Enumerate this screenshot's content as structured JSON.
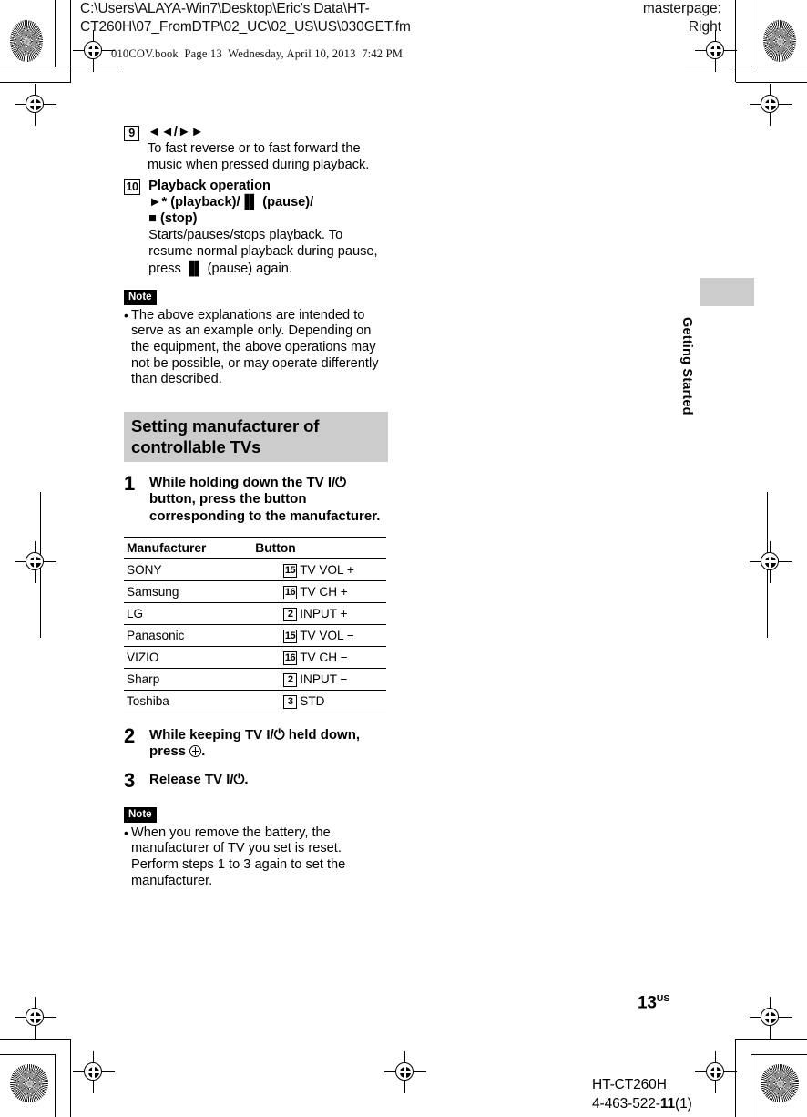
{
  "header": {
    "file_path_line1": "C:\\Users\\ALAYA-Win7\\Desktop\\Eric's Data\\HT-",
    "file_path_line2": "CT260H\\07_FromDTP\\02_UC\\02_US\\US\\030GET.fm",
    "masterpage_label": "masterpage:",
    "masterpage_value": "Right",
    "book_line": "010COV.book  Page 13  Wednesday, April 10, 2013  7:42 PM"
  },
  "body": {
    "items": [
      {
        "number": "9",
        "title": "◄◄/►►",
        "description": "To fast reverse or to fast forward the music when pressed during playback."
      },
      {
        "number": "10",
        "title_line1": "Playback operation",
        "title_line2": "►* (playback)/▐▌ (pause)/",
        "title_line3": "■ (stop)",
        "description_part1": "Starts/pauses/stops playback. To resume normal playback during pause, press ",
        "description_pause_glyph": "▐▌",
        "description_part2": " (pause) again."
      }
    ],
    "note1": {
      "tag": "Note",
      "bullet": "•",
      "text": "The above explanations are intended to serve as an example only. Depending on the equipment, the above operations may not be possible, or may operate differently than described."
    },
    "section_heading": "Setting manufacturer of controllable TVs",
    "steps": [
      {
        "number": "1",
        "text_before": "While holding down the TV ",
        "power_glyph": "I/⏻",
        "text_after": " button, press the button corresponding to the manufacturer."
      },
      {
        "number": "2",
        "text_before": "While keeping TV ",
        "power_glyph": "I/⏻",
        "text_mid": " held down, press ",
        "enter_icon": "enter-icon",
        "text_after": "."
      },
      {
        "number": "3",
        "text_before": "Release TV ",
        "power_glyph": "I/⏻",
        "text_after": "."
      }
    ],
    "table": {
      "columns": [
        "Manufacturer",
        "Button"
      ],
      "rows": [
        {
          "manufacturer": "SONY",
          "button_number": "15",
          "button_label": "TV VOL +"
        },
        {
          "manufacturer": "Samsung",
          "button_number": "16",
          "button_label": "TV CH +"
        },
        {
          "manufacturer": "LG",
          "button_number": "2",
          "button_label": "INPUT +"
        },
        {
          "manufacturer": "Panasonic",
          "button_number": "15",
          "button_label": "TV VOL −"
        },
        {
          "manufacturer": "VIZIO",
          "button_number": "16",
          "button_label": "TV CH −"
        },
        {
          "manufacturer": "Sharp",
          "button_number": "2",
          "button_label": "INPUT −"
        },
        {
          "manufacturer": "Toshiba",
          "button_number": "3",
          "button_label": "STD"
        }
      ]
    },
    "note2": {
      "tag": "Note",
      "bullet": "•",
      "text": "When you remove the battery, the manufacturer of TV you set is reset. Perform steps 1 to 3 again to set the manufacturer."
    }
  },
  "running_head": {
    "vertical_title": "Getting Started"
  },
  "footer": {
    "page_number": "13",
    "page_suffix": "US",
    "model": "HT-CT260H",
    "part_number_prefix": "4-463-522-",
    "part_number_bold": "11",
    "part_number_suffix": "(1)"
  },
  "colors": {
    "section_heading_bg": "#cccccc",
    "tab_block_bg": "#cccccc",
    "note_tag_bg": "#000000",
    "text": "#000000",
    "page_bg": "#ffffff"
  }
}
